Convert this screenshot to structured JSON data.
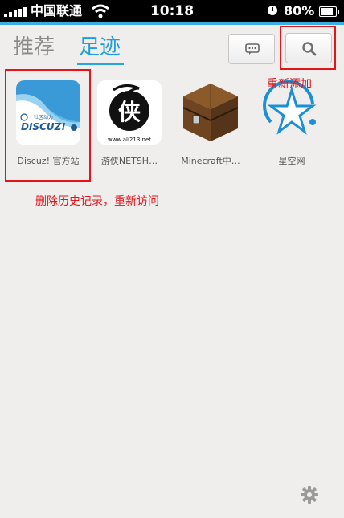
{
  "status_bar": {
    "carrier": "中国联通",
    "time": "10:18",
    "battery": "80%"
  },
  "header": {
    "tab_recommend": "推荐",
    "tab_footprints": "足迹"
  },
  "sites": [
    {
      "label": "Discuz! 官方站",
      "logo_text": "社区动力",
      "logo_brand": "DISCUZ!"
    },
    {
      "label": "游侠NETSH…",
      "logo_char": "侠",
      "logo_url": "www.ali213.net"
    },
    {
      "label": "Minecraft中…"
    },
    {
      "label": "星空网"
    }
  ],
  "annotations": {
    "readd": "重新添加",
    "delete_history": "删除历史记录，重新访问"
  },
  "colors": {
    "accent": "#28a5df",
    "annotation_red": "#e4141b"
  }
}
